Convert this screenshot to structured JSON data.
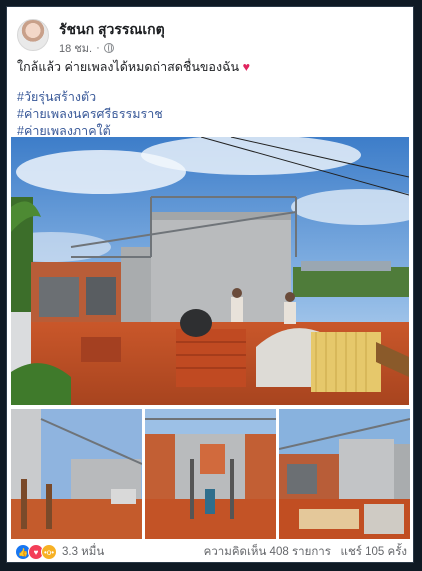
{
  "post": {
    "author": "รัชนก สุวรรณเกตุ",
    "time": "18 ชม.",
    "text": "ใกล้แล้ว ค่ายเพลงได้หมดถ่าสดชื่นของฉัน",
    "heart": "♥",
    "hashtags": [
      "#วัยรุ่นสร้างตัว",
      "#ค่ายเพลงนครศรีธรรมราช",
      "#ค่ายเพลงภาคใต้"
    ]
  },
  "footer": {
    "reaction_count": "3.3 หมื่น",
    "comments": "ความคิดเห็น 408 รายการ",
    "shares": "แชร์ 105 ครั้ง"
  },
  "icons": {
    "like": "thumbs-up-icon",
    "love": "heart-icon",
    "wow": "wow-face-icon"
  },
  "colors": {
    "link": "#385898",
    "heart": "#e0245e",
    "like": "#1877f2",
    "love": "#f33e58",
    "wow": "#f7b125"
  }
}
